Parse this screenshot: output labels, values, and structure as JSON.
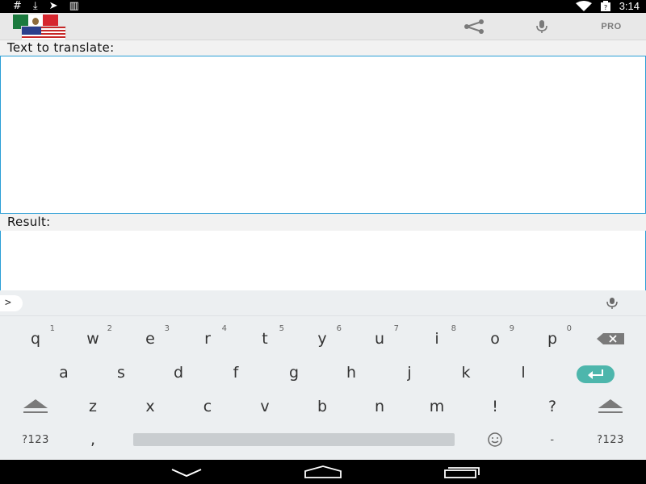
{
  "status_bar": {
    "left_icons": [
      "hash-icon",
      "download-icon",
      "send-icon",
      "sd-card-icon"
    ],
    "left_glyphs": [
      "#",
      "⤓",
      "➤",
      "▥"
    ],
    "right_icons": [
      "wifi-icon",
      "battery-icon"
    ],
    "time": "3:14"
  },
  "action_bar": {
    "flags": [
      "mexico-flag",
      "usa-flag"
    ],
    "share_icon": "share-icon",
    "mic_icon": "mic-icon",
    "pro_label": "PRO"
  },
  "main": {
    "input_label": "Text to translate:",
    "input_value": "",
    "result_label": "Result:",
    "result_value": ""
  },
  "suggestion_strip": {
    "expand_label": ">",
    "mic_icon": "mic-icon"
  },
  "keyboard": {
    "row1": [
      {
        "key": "q",
        "hint": "1"
      },
      {
        "key": "w",
        "hint": "2"
      },
      {
        "key": "e",
        "hint": "3"
      },
      {
        "key": "r",
        "hint": "4"
      },
      {
        "key": "t",
        "hint": "5"
      },
      {
        "key": "y",
        "hint": "6"
      },
      {
        "key": "u",
        "hint": "7"
      },
      {
        "key": "i",
        "hint": "8"
      },
      {
        "key": "o",
        "hint": "9"
      },
      {
        "key": "p",
        "hint": "0"
      }
    ],
    "row2": [
      "a",
      "s",
      "d",
      "f",
      "g",
      "h",
      "j",
      "k",
      "l"
    ],
    "row3": [
      "z",
      "x",
      "c",
      "v",
      "b",
      "n",
      "m",
      "!",
      "?"
    ],
    "symbols_left": "?123",
    "comma": ",",
    "dash": "-",
    "symbols_right": "?123",
    "icons": {
      "backspace": "backspace-icon",
      "enter": "enter-icon",
      "shift": "shift-icon",
      "emoji": "emoji-icon"
    }
  },
  "nav_bar": {
    "icons": [
      "back-icon",
      "home-icon",
      "recents-icon"
    ]
  },
  "colors": {
    "accent": "#2a9ed6",
    "enter_key": "#4db6ac",
    "keyboard_bg": "#eceff1"
  }
}
